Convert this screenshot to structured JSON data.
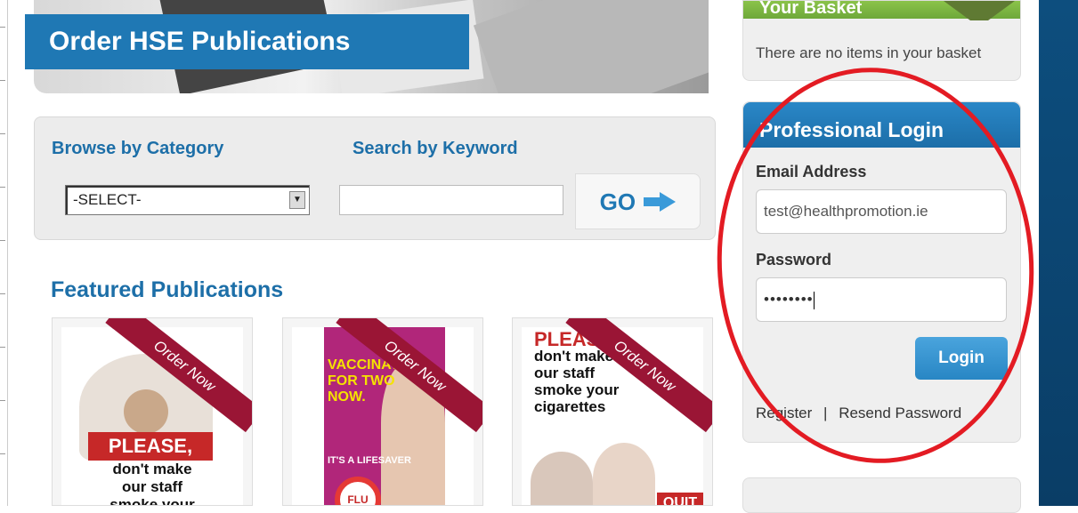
{
  "page": {
    "title": "Order HSE Publications"
  },
  "search": {
    "browse_label": "Browse by Category",
    "keyword_label": "Search by Keyword",
    "select_value": "-SELECT-",
    "keyword_value": "",
    "go_label": "GO"
  },
  "featured": {
    "heading": "Featured Publications",
    "items": [
      {
        "ribbon": "Order Now",
        "cover_lines": [
          "PLEASE,",
          "don't make",
          "our staff",
          "smoke your"
        ]
      },
      {
        "ribbon": "Order Now",
        "cover_lines": [
          "VACCINATE",
          "FOR TWO NOW.",
          "IT'S A LIFESAVER",
          "FLU"
        ]
      },
      {
        "ribbon": "Order Now",
        "cover_lines": [
          "PLEASE",
          "don't make",
          "our staff",
          "smoke your",
          "cigarettes",
          "QUIT"
        ]
      }
    ]
  },
  "basket": {
    "heading": "Your Basket",
    "empty_text": "There are no items in your basket"
  },
  "login": {
    "heading": "Professional Login",
    "email_label": "Email Address",
    "email_value": "test@healthpromotion.ie",
    "password_label": "Password",
    "password_value": "••••••••",
    "button_label": "Login",
    "register_link": "Register",
    "separator": "|",
    "resend_link": "Resend Password"
  },
  "colors": {
    "brand_blue": "#1f78b4",
    "ribbon": "#9a1535",
    "highlight": "#e31b23",
    "basket_green": "#8bc34a"
  }
}
